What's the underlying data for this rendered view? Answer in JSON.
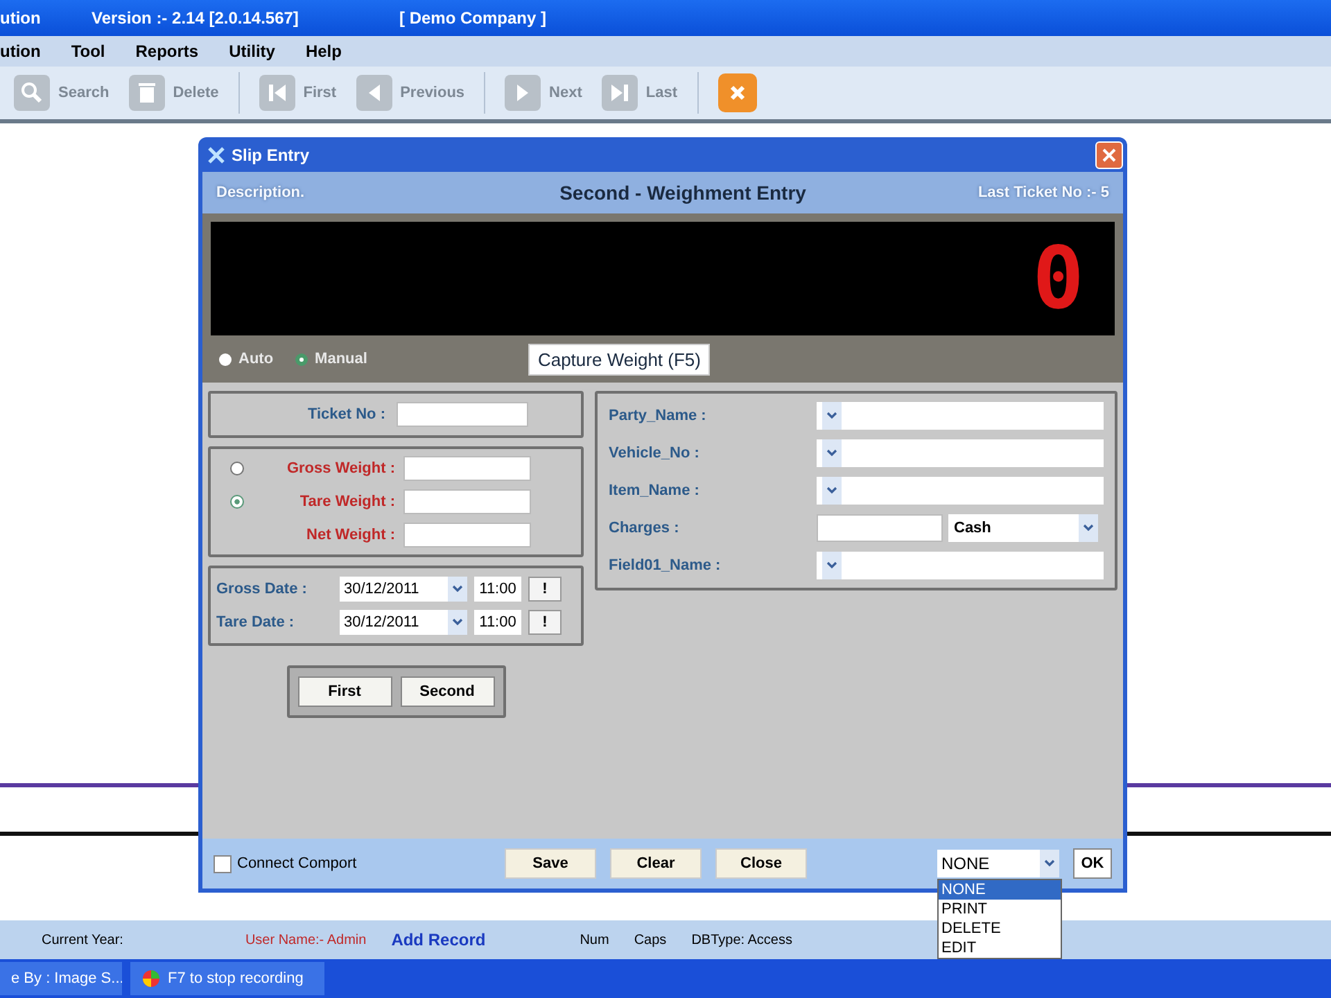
{
  "app_window": {
    "title_fragment": "ution",
    "version": "Version :- 2.14 [2.0.14.567]",
    "company": "[ Demo Company ]"
  },
  "menu": [
    {
      "label": "ution"
    },
    {
      "label": "Tool"
    },
    {
      "label": "Reports"
    },
    {
      "label": "Utility"
    },
    {
      "label": "Help"
    }
  ],
  "toolbar": [
    {
      "label": "Search",
      "kind": "search",
      "disabled": true
    },
    {
      "label": "Delete",
      "kind": "delete",
      "disabled": true
    },
    {
      "label": "First",
      "kind": "first",
      "disabled": true
    },
    {
      "label": "Previous",
      "kind": "previous",
      "disabled": true
    },
    {
      "label": "Next",
      "kind": "next",
      "disabled": true
    },
    {
      "label": "Last",
      "kind": "last",
      "disabled": true
    }
  ],
  "dialog": {
    "title": "Slip Entry",
    "description_label": "Description.",
    "heading": "Second - Weighment Entry",
    "last_ticket": "Last Ticket No :- 5",
    "display_value": "0",
    "modes": [
      {
        "label": "Auto",
        "selected": false
      },
      {
        "label": "Manual",
        "selected": true
      }
    ],
    "capture_button": "Capture Weight (F5)",
    "ticket_label": "Ticket No :",
    "weights": [
      {
        "label": "Gross Weight :",
        "kind": "radio",
        "selected": false
      },
      {
        "label": "Tare Weight   :",
        "kind": "radio",
        "selected": true
      },
      {
        "label": "Net Weight :",
        "kind": "plain"
      }
    ],
    "dates": [
      {
        "label": "Gross Date :",
        "date": "30/12/2011",
        "time": "11:00",
        "button": "!"
      },
      {
        "label": "Tare Date :",
        "date": "30/12/2011",
        "time": "11:00",
        "button": "!"
      }
    ],
    "entry_buttons": [
      "First",
      "Second"
    ],
    "fields": [
      {
        "label": "Party_Name :",
        "kind": "combo"
      },
      {
        "label": "Vehicle_No :",
        "kind": "combo"
      },
      {
        "label": "Item_Name :",
        "kind": "combo"
      },
      {
        "label": "Charges :",
        "kind": "charges",
        "value": "Cash"
      },
      {
        "label": "Field01_Name :",
        "kind": "combo"
      }
    ],
    "connect_comport": {
      "label": "Connect Comport",
      "checked": false
    },
    "footer_buttons": [
      "Save",
      "Clear",
      "Close"
    ],
    "mode_select": {
      "value": "NONE",
      "ok": "OK",
      "options": [
        {
          "label": "NONE",
          "selected": true
        },
        {
          "label": "PRINT",
          "selected": false
        },
        {
          "label": "DELETE",
          "selected": false
        },
        {
          "label": "EDIT",
          "selected": false
        }
      ]
    }
  },
  "status_bar": [
    {
      "text": "Current Year:",
      "kind": "plain"
    },
    {
      "text": "User Name:- Admin",
      "kind": "user"
    },
    {
      "text": "Add Record",
      "kind": "mode"
    },
    {
      "text": "Num",
      "kind": "plain"
    },
    {
      "text": "Caps",
      "kind": "plain"
    },
    {
      "text": "DBType: Access",
      "kind": "plain"
    }
  ],
  "taskbar": [
    {
      "label": "e By : Image S...",
      "kind": "window"
    },
    {
      "label": "F7 to stop recording",
      "kind": "recorder"
    }
  ]
}
